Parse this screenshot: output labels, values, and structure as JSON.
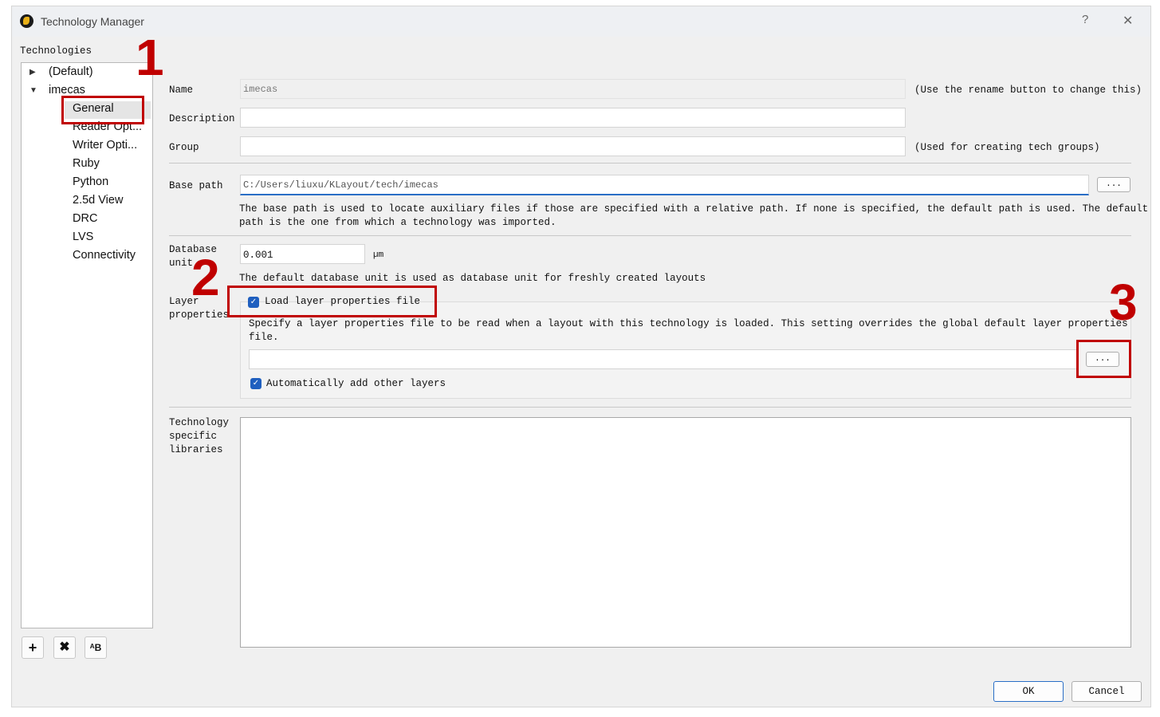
{
  "window": {
    "title": "Technology Manager",
    "help": "?",
    "close": "✕"
  },
  "tree": {
    "header": "Technologies",
    "items": [
      {
        "label": "(Default)",
        "expander": "▶"
      },
      {
        "label": "imecas",
        "expander": "▼"
      },
      {
        "label": "General"
      },
      {
        "label": "Reader Opt..."
      },
      {
        "label": "Writer Opti..."
      },
      {
        "label": "Ruby"
      },
      {
        "label": "Python"
      },
      {
        "label": "2.5d View"
      },
      {
        "label": "DRC"
      },
      {
        "label": "LVS"
      },
      {
        "label": "Connectivity"
      }
    ]
  },
  "toolbar": {
    "add": "+",
    "remove": "✖",
    "rename": "ᴬB"
  },
  "form": {
    "name_label": "Name",
    "name_value": "imecas",
    "name_hint": "(Use the rename button to change this)",
    "description_label": "Description",
    "description_value": "",
    "group_label": "Group",
    "group_value": "",
    "group_hint": "(Used for creating tech groups)",
    "base_path_label": "Base path",
    "base_path_value": "C:/Users/liuxu/KLayout/tech/imecas",
    "browse": "...",
    "base_path_help_1": "The base path is used to locate auxiliary files if those are specified with a relative path. If none is specified, the default path is used. The default",
    "base_path_help_2": "path is the one from which a technology was imported.",
    "dbu_label_1": "Database",
    "dbu_label_2": "unit",
    "dbu_value": "0.001",
    "dbu_unit": "µm",
    "dbu_help": "The default database unit is used as database unit for freshly created layouts",
    "layer_label_1": "Layer",
    "layer_label_2": "properties",
    "load_layer_props": "Load layer properties file",
    "layer_help_1": "Specify a layer properties file to be read when a layout with this technology is loaded. This setting overrides the global default layer properties",
    "layer_help_2": "file.",
    "layer_file_value": "",
    "auto_add_layers": "Automatically add other layers",
    "libs_label_1": "Technology",
    "libs_label_2": "specific",
    "libs_label_3": "libraries",
    "check": "✓"
  },
  "dialog": {
    "ok": "OK",
    "cancel": "Cancel"
  },
  "annotations": {
    "n1": "1",
    "n2": "2",
    "n3": "3"
  }
}
